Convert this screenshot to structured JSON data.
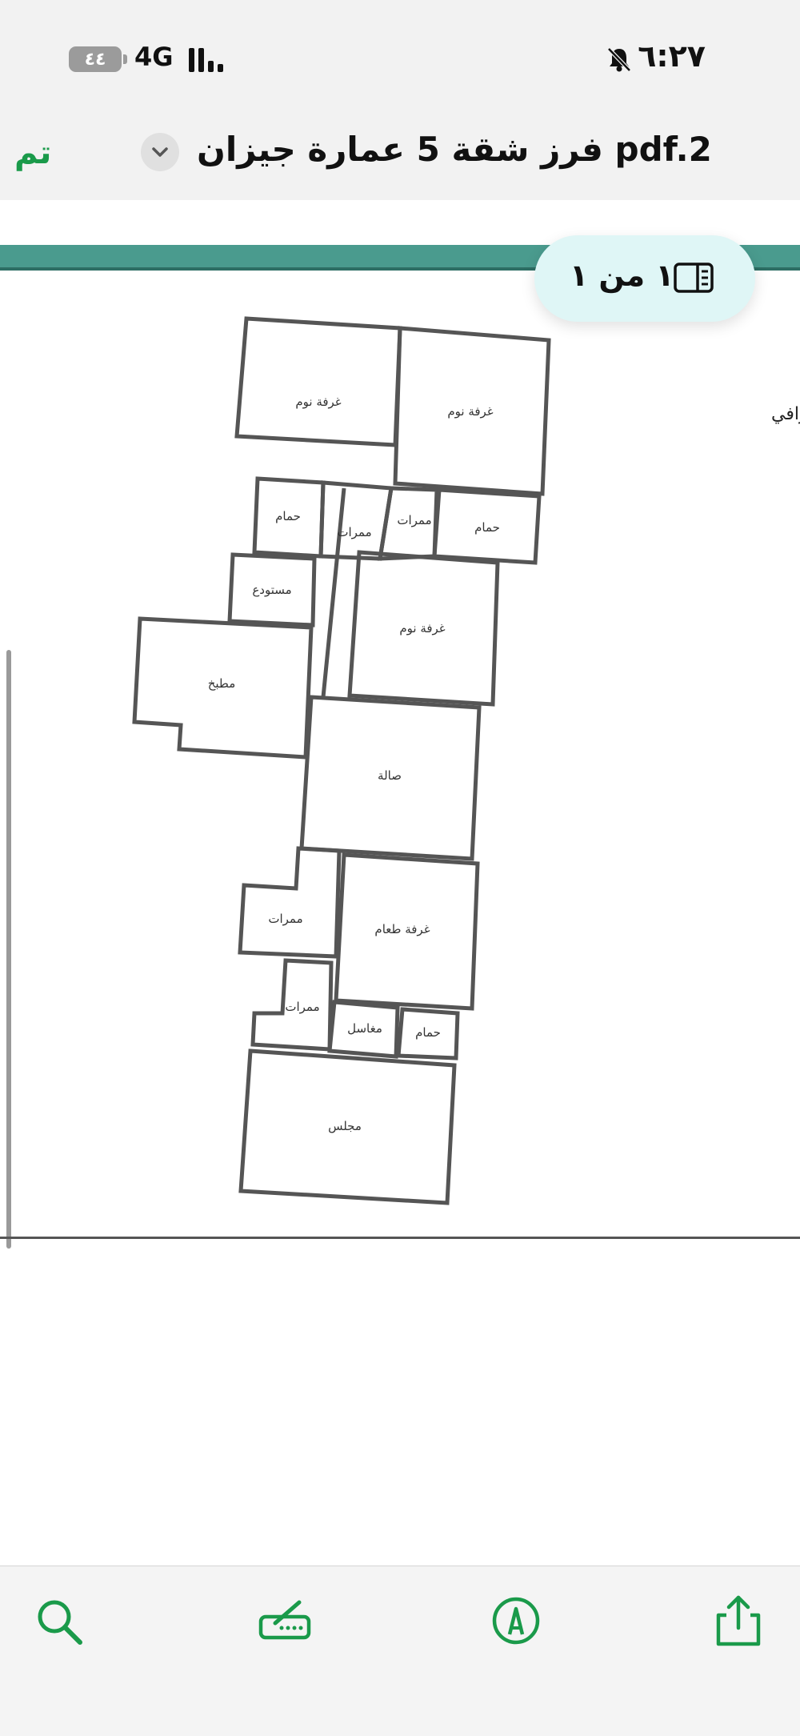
{
  "status": {
    "battery": "٤٤",
    "network": "4G",
    "time": "٦:٢٧"
  },
  "nav": {
    "done_label": "تم",
    "document_title": "فرز شقة 5 عمارة جيزان pdf.2"
  },
  "viewer": {
    "page_indicator": "١ من ١",
    "side_text": "رافي"
  },
  "floorplan": {
    "rooms": {
      "bedroom_1": "غرفة نوم",
      "bedroom_2": "غرفة نوم",
      "bathroom_1": "حمام",
      "corridor_1": "ممرات",
      "corridor_2": "ممرات",
      "bathroom_2": "حمام",
      "storage": "مستودع",
      "bedroom_3": "غرفة نوم",
      "kitchen": "مطبخ",
      "hall": "صالة",
      "corridor_3": "ممرات",
      "dining": "غرفة طعام",
      "corridor_4": "ممرات",
      "sinks": "مغاسل",
      "bathroom_3": "حمام",
      "majlis": "مجلس"
    }
  },
  "colors": {
    "accent_green": "#1a9a4a",
    "teal_header": "#4a9b8e",
    "pill_bg": "#dff6f6"
  },
  "icons": {
    "mute": "bell-slash-icon",
    "page": "sidebar-icon",
    "search": "search-icon",
    "markup": "markup-icon",
    "annotate": "pen-circle-icon",
    "share": "share-icon"
  }
}
